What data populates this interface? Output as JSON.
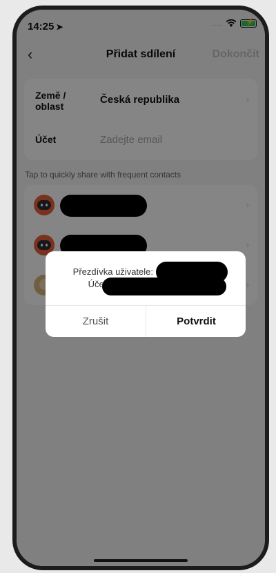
{
  "status_bar": {
    "time": "14:25",
    "signal": "...."
  },
  "nav": {
    "back_glyph": "‹",
    "title": "Přidat sdílení",
    "done_label": "Dokončit"
  },
  "form": {
    "country_label_line1": "Země /",
    "country_label_line2": "oblast",
    "country_value": "Česká republika",
    "account_label": "Účet",
    "account_placeholder": "Zadejte email"
  },
  "hint": "Tap to quickly share with frequent contacts",
  "contacts": [
    {
      "avatar": "robot-avatar"
    },
    {
      "avatar": "robot-avatar"
    },
    {
      "avatar": "person-avatar"
    }
  ],
  "dialog": {
    "nickname_label": "Přezdívka uživatele:",
    "account_label": "Účet:",
    "cancel_label": "Zrušit",
    "confirm_label": "Potvrdit"
  },
  "colors": {
    "accent_disabled": "#c2c2c2",
    "avatar_orange": "#e8613a",
    "battery_green": "#35c759"
  }
}
